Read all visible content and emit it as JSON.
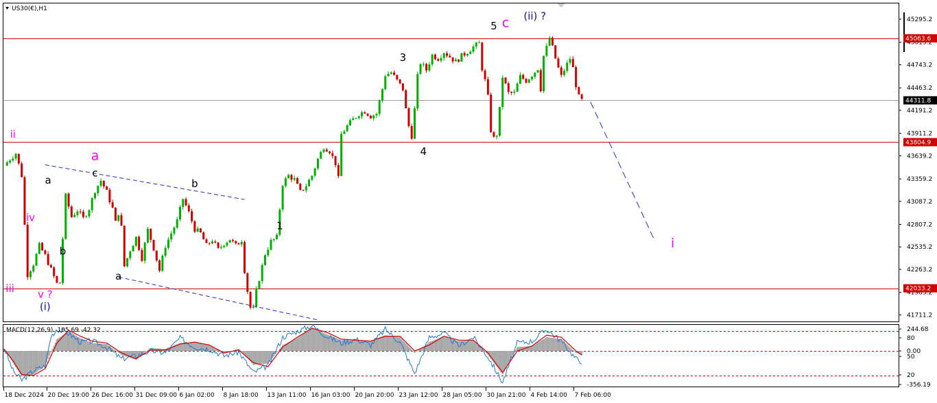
{
  "chart_header": {
    "symbol_label": "US30(€),H1"
  },
  "macd_header": {
    "label": "MACD(12,26,9) -105.69 -42.32"
  },
  "colors": {
    "bull": "#00b000",
    "bear": "#d00000",
    "level_line": "#d00000",
    "current_line": "#a0a0a0",
    "level_box": "#d00000",
    "current_box": "#000000",
    "trendline": "#1f2fc0",
    "projection": "#1f2fc0",
    "magenta": "#ff00ff",
    "navy": "#1010c0",
    "macd_line": "#1e78d2",
    "signal_line": "#d00000",
    "histogram": "#a9a9a9",
    "grid_dash": "#d00000"
  },
  "chart_data": [
    {
      "type": "line",
      "title": "",
      "x_ticks": [
        "18 Dec 2024",
        "20 Dec 19:00",
        "26 Dec 16:00",
        "31 Dec 09:00",
        "6 Jan 02:00",
        "8 Jan 18:00",
        "13 Jan 11:00",
        "16 Jan 03:00",
        "20 Jan 20:00",
        "23 Jan 12:00",
        "28 Jan 05:00",
        "30 Jan 21:00",
        "4 Feb 14:00",
        "7 Feb 06:00"
      ],
      "y_ticks": [
        "45295.2",
        "45015.2",
        "44743.2",
        "44463.2",
        "44191.2",
        "43911.2",
        "43639.2",
        "43359.2",
        "43087.2",
        "42807.2",
        "42535.2",
        "42263.2",
        "41983.2",
        "41711.2"
      ],
      "ylim": [
        41640,
        45470
      ],
      "price_path": [
        [
          0,
          43520
        ],
        [
          2,
          43600
        ],
        [
          4,
          43670
        ],
        [
          6,
          43400
        ],
        [
          8,
          42200
        ],
        [
          10,
          42330
        ],
        [
          12,
          42550
        ],
        [
          14,
          42430
        ],
        [
          16,
          42260
        ],
        [
          18,
          42090
        ],
        [
          19,
          42100
        ],
        [
          20,
          42640
        ],
        [
          21,
          43150
        ],
        [
          23,
          42900
        ],
        [
          25,
          42980
        ],
        [
          27,
          42880
        ],
        [
          29,
          43000
        ],
        [
          31,
          43220
        ],
        [
          33,
          43340
        ],
        [
          35,
          43200
        ],
        [
          37,
          43000
        ],
        [
          38,
          42830
        ],
        [
          39,
          42950
        ],
        [
          40,
          42770
        ],
        [
          41,
          42300
        ],
        [
          43,
          42500
        ],
        [
          45,
          42650
        ],
        [
          47,
          42400
        ],
        [
          49,
          42740
        ],
        [
          51,
          42520
        ],
        [
          53,
          42250
        ],
        [
          55,
          42550
        ],
        [
          57,
          42700
        ],
        [
          59,
          42850
        ],
        [
          61,
          43120
        ],
        [
          63,
          42950
        ],
        [
          65,
          42750
        ],
        [
          67,
          42700
        ],
        [
          69,
          42550
        ],
        [
          71,
          42620
        ],
        [
          73,
          42500
        ],
        [
          75,
          42580
        ],
        [
          77,
          42630
        ],
        [
          79,
          42550
        ],
        [
          81,
          42620
        ],
        [
          82,
          42250
        ],
        [
          83,
          42000
        ],
        [
          84,
          41800
        ],
        [
          85,
          41780
        ],
        [
          86,
          42000
        ],
        [
          87,
          42150
        ],
        [
          88,
          42300
        ],
        [
          89,
          42450
        ],
        [
          91,
          42600
        ],
        [
          93,
          42650
        ],
        [
          94,
          43000
        ],
        [
          95,
          43300
        ],
        [
          97,
          43400
        ],
        [
          99,
          43350
        ],
        [
          101,
          43200
        ],
        [
          103,
          43280
        ],
        [
          105,
          43400
        ],
        [
          107,
          43600
        ],
        [
          109,
          43750
        ],
        [
          111,
          43700
        ],
        [
          113,
          43550
        ],
        [
          114,
          43360
        ],
        [
          115,
          43900
        ],
        [
          117,
          44000
        ],
        [
          119,
          44080
        ],
        [
          121,
          44150
        ],
        [
          123,
          44180
        ],
        [
          125,
          44120
        ],
        [
          127,
          44150
        ],
        [
          129,
          44450
        ],
        [
          130,
          44620
        ],
        [
          132,
          44650
        ],
        [
          134,
          44550
        ],
        [
          136,
          44450
        ],
        [
          137,
          44200
        ],
        [
          138,
          44000
        ],
        [
          139,
          43880
        ],
        [
          140,
          44200
        ],
        [
          141,
          44600
        ],
        [
          142,
          44770
        ],
        [
          144,
          44680
        ],
        [
          146,
          44860
        ],
        [
          148,
          44820
        ],
        [
          150,
          44900
        ],
        [
          152,
          44840
        ],
        [
          154,
          44780
        ],
        [
          156,
          44850
        ],
        [
          158,
          44900
        ],
        [
          160,
          44960
        ],
        [
          162,
          45000
        ],
        [
          163,
          44700
        ],
        [
          164,
          44550
        ],
        [
          165,
          44350
        ],
        [
          166,
          43950
        ],
        [
          167,
          43850
        ],
        [
          168,
          43900
        ],
        [
          169,
          44200
        ],
        [
          170,
          44600
        ],
        [
          171,
          44500
        ],
        [
          172,
          44400
        ],
        [
          174,
          44400
        ],
        [
          176,
          44600
        ],
        [
          178,
          44550
        ],
        [
          180,
          44620
        ],
        [
          182,
          44700
        ],
        [
          183,
          44450
        ],
        [
          184,
          44850
        ],
        [
          185,
          44950
        ],
        [
          186,
          45070
        ],
        [
          187,
          44950
        ],
        [
          188,
          44820
        ],
        [
          189,
          44700
        ],
        [
          190,
          44600
        ],
        [
          191,
          44680
        ],
        [
          192,
          44750
        ],
        [
          193,
          44820
        ],
        [
          194,
          44700
        ],
        [
          195,
          44500
        ],
        [
          196,
          44350
        ],
        [
          197,
          44311
        ]
      ],
      "levels": [
        {
          "name": "upper",
          "value": "45063.6",
          "price": 45063.6
        },
        {
          "name": "current",
          "value": "44311.8",
          "price": 44311.8
        },
        {
          "name": "middle",
          "value": "43804.9",
          "price": 43804.9
        },
        {
          "name": "lower",
          "value": "42033.2",
          "price": 42033.2
        }
      ],
      "projection_target_price": 42600,
      "wave_labels": [
        {
          "text": "ii",
          "color": "magenta",
          "bar": 3,
          "price": 43860
        },
        {
          "text": "iii",
          "color": "magenta",
          "bar": 2,
          "price": 41990
        },
        {
          "text": "iv",
          "color": "magenta",
          "bar": 9,
          "price": 42850
        },
        {
          "text": "v ?",
          "color": "magenta",
          "bar": 14,
          "price": 41920
        },
        {
          "text": "(i)",
          "color": "navy",
          "bar": 14,
          "price": 41770
        },
        {
          "text": "a",
          "color": "black",
          "bar": 15,
          "price": 43300
        },
        {
          "text": "b",
          "color": "black",
          "bar": 20,
          "price": 42440
        },
        {
          "text": "a",
          "color": "magenta",
          "bar": 31,
          "price": 43590
        },
        {
          "text": "c",
          "color": "black",
          "bar": 31,
          "price": 43390
        },
        {
          "text": "b",
          "color": "black",
          "bar": 65,
          "price": 43260
        },
        {
          "text": "a",
          "color": "black",
          "bar": 39,
          "price": 42140
        },
        {
          "text": "1",
          "color": "black",
          "bar": 94,
          "price": 42750
        },
        {
          "text": "3",
          "color": "black",
          "bar": 136,
          "price": 44790
        },
        {
          "text": "4",
          "color": "black",
          "bar": 143,
          "price": 43650
        },
        {
          "text": "5",
          "color": "black",
          "bar": 167,
          "price": 45170
        },
        {
          "text": "c",
          "color": "magenta",
          "bar": 171,
          "price": 45200
        },
        {
          "text": "(ii) ?",
          "color": "navy",
          "bar": 181,
          "price": 45290
        },
        {
          "text": "i",
          "color": "magenta",
          "bar": 228,
          "price": 42530
        }
      ]
    },
    {
      "type": "line",
      "title": "",
      "y_ticks": [
        "244.68",
        "80",
        "0.00",
        "50",
        "20",
        "-356.19"
      ],
      "ylim": [
        -356.19,
        244.68
      ],
      "dashed_levels": [
        {
          "name": "upper",
          "price": 200
        },
        {
          "name": "lower",
          "price": -250
        }
      ],
      "series": [
        {
          "kind": "histogram",
          "points": [
            [
              0,
              20
            ],
            [
              3,
              -120
            ],
            [
              6,
              -260
            ],
            [
              10,
              -240
            ],
            [
              14,
              -150
            ],
            [
              18,
              120
            ],
            [
              22,
              200
            ],
            [
              26,
              130
            ],
            [
              30,
              80
            ],
            [
              35,
              70
            ],
            [
              40,
              -40
            ],
            [
              45,
              -90
            ],
            [
              50,
              30
            ],
            [
              55,
              20
            ],
            [
              60,
              80
            ],
            [
              65,
              90
            ],
            [
              70,
              60
            ],
            [
              75,
              -30
            ],
            [
              80,
              20
            ],
            [
              85,
              -140
            ],
            [
              90,
              -130
            ],
            [
              95,
              60
            ],
            [
              100,
              130
            ],
            [
              105,
              240
            ],
            [
              110,
              170
            ],
            [
              115,
              110
            ],
            [
              120,
              110
            ],
            [
              125,
              100
            ],
            [
              130,
              160
            ],
            [
              135,
              140
            ],
            [
              140,
              -20
            ],
            [
              145,
              90
            ],
            [
              150,
              150
            ],
            [
              155,
              100
            ],
            [
              160,
              110
            ],
            [
              165,
              -40
            ],
            [
              170,
              -240
            ],
            [
              175,
              40
            ],
            [
              180,
              50
            ],
            [
              185,
              140
            ],
            [
              190,
              120
            ],
            [
              195,
              -20
            ],
            [
              197,
              -42
            ]
          ]
        },
        {
          "kind": "macd",
          "points": [
            [
              0,
              30
            ],
            [
              3,
              -200
            ],
            [
              6,
              -300
            ],
            [
              10,
              -200
            ],
            [
              14,
              -150
            ],
            [
              16,
              150
            ],
            [
              18,
              220
            ],
            [
              22,
              180
            ],
            [
              26,
              90
            ],
            [
              30,
              100
            ],
            [
              35,
              40
            ],
            [
              40,
              -80
            ],
            [
              45,
              -50
            ],
            [
              50,
              0
            ],
            [
              55,
              -20
            ],
            [
              60,
              130
            ],
            [
              65,
              40
            ],
            [
              70,
              20
            ],
            [
              75,
              -50
            ],
            [
              80,
              -10
            ],
            [
              85,
              -220
            ],
            [
              90,
              -150
            ],
            [
              95,
              140
            ],
            [
              100,
              200
            ],
            [
              105,
              260
            ],
            [
              110,
              150
            ],
            [
              115,
              80
            ],
            [
              120,
              120
            ],
            [
              125,
              60
            ],
            [
              130,
              220
            ],
            [
              135,
              90
            ],
            [
              140,
              -230
            ],
            [
              145,
              140
            ],
            [
              150,
              180
            ],
            [
              155,
              50
            ],
            [
              160,
              140
            ],
            [
              165,
              -60
            ],
            [
              170,
              -320
            ],
            [
              175,
              80
            ],
            [
              180,
              100
            ],
            [
              185,
              220
            ],
            [
              190,
              100
            ],
            [
              195,
              -80
            ],
            [
              197,
              -106
            ]
          ]
        },
        {
          "kind": "signal",
          "points": [
            [
              0,
              20
            ],
            [
              3,
              -100
            ],
            [
              6,
              -240
            ],
            [
              10,
              -250
            ],
            [
              14,
              -180
            ],
            [
              18,
              80
            ],
            [
              22,
              210
            ],
            [
              26,
              150
            ],
            [
              30,
              100
            ],
            [
              35,
              80
            ],
            [
              40,
              -20
            ],
            [
              45,
              -80
            ],
            [
              50,
              10
            ],
            [
              55,
              10
            ],
            [
              60,
              70
            ],
            [
              65,
              90
            ],
            [
              70,
              60
            ],
            [
              75,
              -20
            ],
            [
              80,
              10
            ],
            [
              85,
              -120
            ],
            [
              90,
              -160
            ],
            [
              95,
              40
            ],
            [
              100,
              140
            ],
            [
              105,
              230
            ],
            [
              110,
              190
            ],
            [
              115,
              120
            ],
            [
              120,
              110
            ],
            [
              125,
              100
            ],
            [
              130,
              150
            ],
            [
              135,
              150
            ],
            [
              140,
              0
            ],
            [
              145,
              60
            ],
            [
              150,
              150
            ],
            [
              155,
              110
            ],
            [
              160,
              110
            ],
            [
              165,
              -20
            ],
            [
              170,
              -220
            ],
            [
              175,
              0
            ],
            [
              180,
              50
            ],
            [
              185,
              160
            ],
            [
              190,
              140
            ],
            [
              195,
              0
            ],
            [
              197,
              -42
            ]
          ]
        }
      ]
    }
  ]
}
